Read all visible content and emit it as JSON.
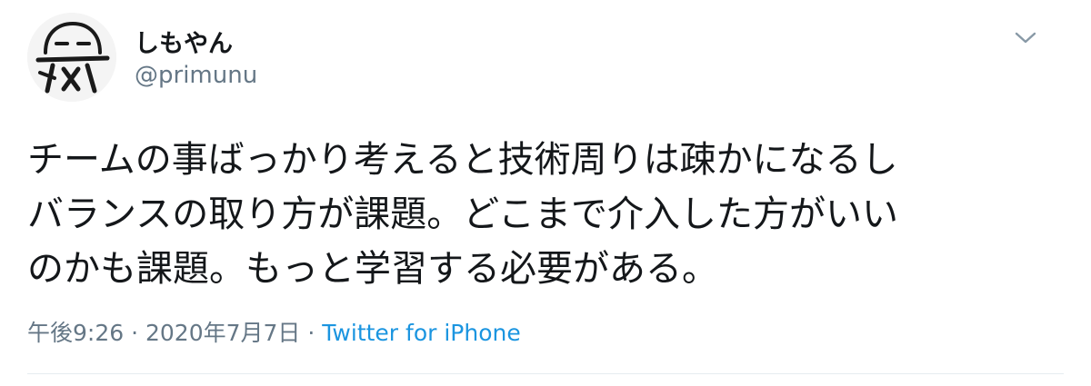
{
  "author": {
    "display_name": "しもやん",
    "handle": "@primunu",
    "avatar_icon": "hand-drawn-face-avatar"
  },
  "more_icon": "chevron-down-icon",
  "tweet": {
    "lines": [
      "チームの事ばっかり考えると技術周りは疎かになるし",
      "バランスの取り方が課題。どこまで介入した方がいい",
      "のかも課題。もっと学習する必要がある。"
    ]
  },
  "meta": {
    "time": "午後9:26",
    "separator": "·",
    "date": "2020年7月7日",
    "source": "Twitter for iPhone"
  },
  "colors": {
    "text": "#14171a",
    "secondary": "#657786",
    "link": "#1b95e0",
    "divider": "#e6ecf0"
  }
}
